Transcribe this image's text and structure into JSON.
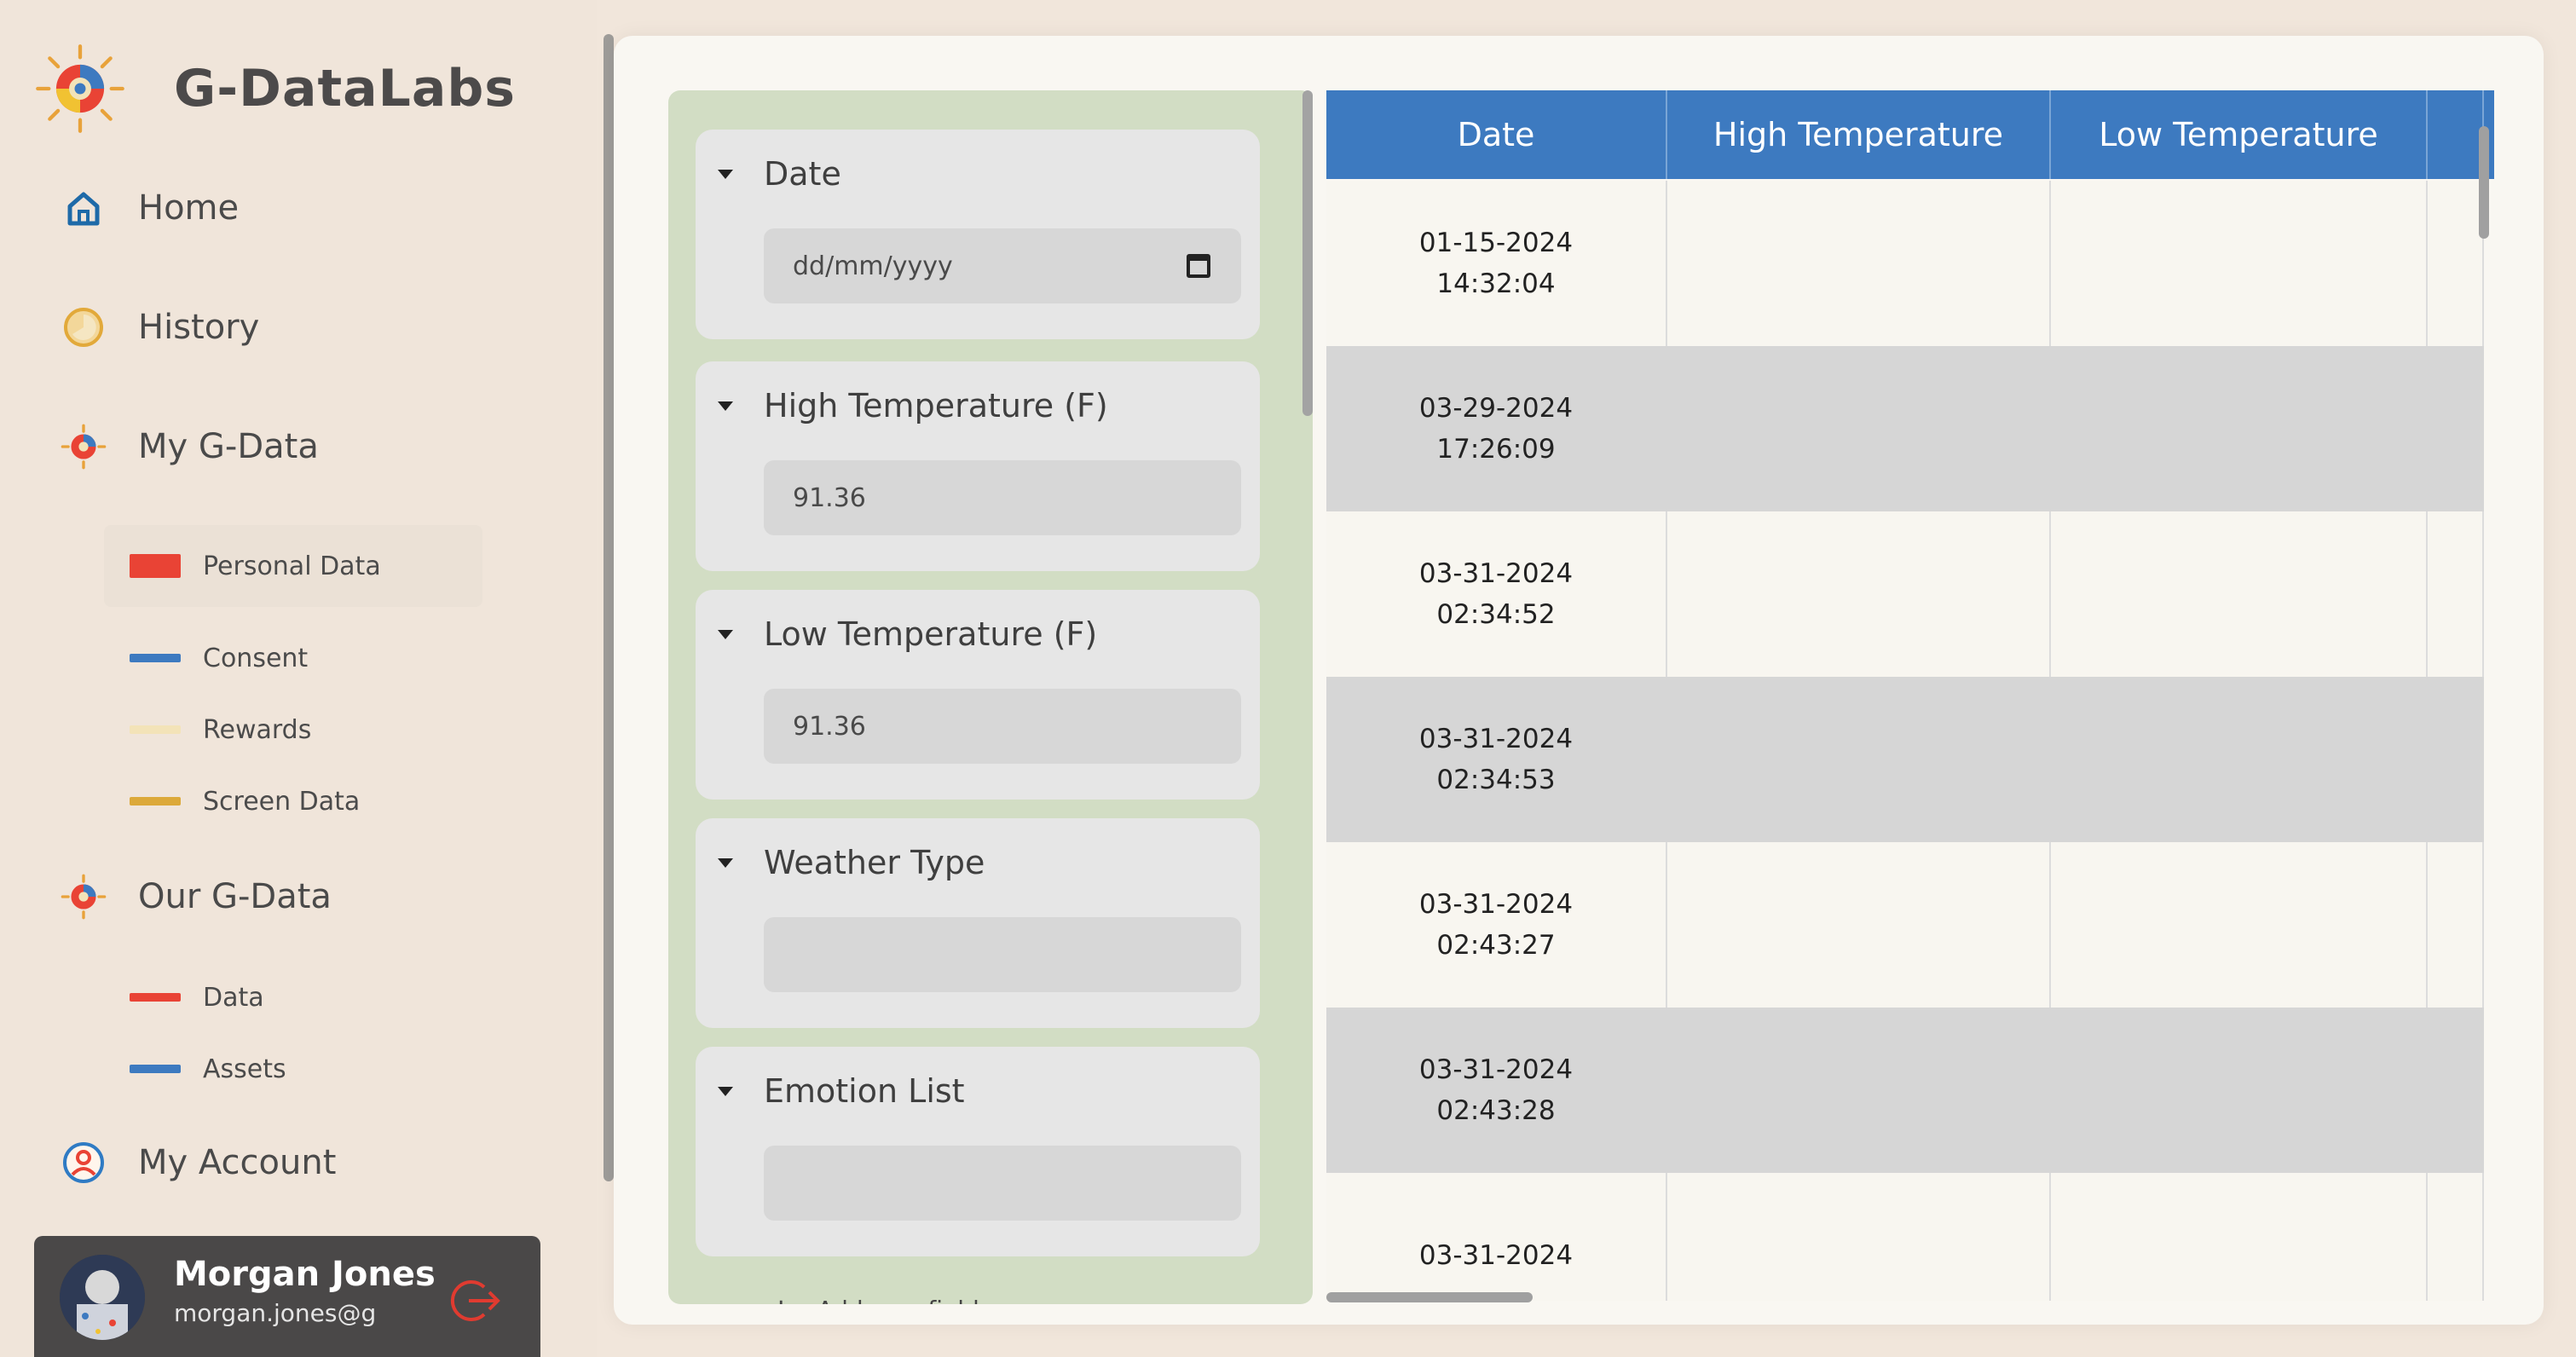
{
  "brand": {
    "name": "G-DataLabs"
  },
  "nav": {
    "home": "Home",
    "history": "History",
    "my_gdata": "My G-Data",
    "my_gdata_items": [
      "Personal Data",
      "Consent",
      "Rewards",
      "Screen Data"
    ],
    "our_gdata": "Our G-Data",
    "our_gdata_items": [
      "Data",
      "Assets"
    ],
    "my_account": "My Account"
  },
  "colors": {
    "red": "#e94335",
    "blue": "#3d7ac0",
    "cream": "#f3e3b8",
    "gold": "#dca93a",
    "header_blue": "#3d7ac0",
    "panel_green": "#d2ddc4"
  },
  "user": {
    "name": "Morgan Jones",
    "email": "morgan.jones@g"
  },
  "form": {
    "fields": [
      {
        "label": "Date",
        "value": "",
        "placeholder": "dd/mm/yyyy"
      },
      {
        "label": "High Temperature (F)",
        "value": "91.36"
      },
      {
        "label": "Low Temperature (F)",
        "value": "91.36"
      },
      {
        "label": "Weather Type",
        "value": ""
      },
      {
        "label": "Emotion List",
        "value": ""
      }
    ],
    "add_field": "Add new field"
  },
  "table": {
    "columns": [
      "Date",
      "High Temperature",
      "Low Temperature"
    ],
    "rows": [
      {
        "date": "01-15-2024",
        "time": "14:32:04"
      },
      {
        "date": "03-29-2024",
        "time": "17:26:09"
      },
      {
        "date": "03-31-2024",
        "time": "02:34:52"
      },
      {
        "date": "03-31-2024",
        "time": "02:34:53"
      },
      {
        "date": "03-31-2024",
        "time": "02:43:27"
      },
      {
        "date": "03-31-2024",
        "time": "02:43:28"
      },
      {
        "date": "03-31-2024",
        "time": ""
      }
    ]
  }
}
